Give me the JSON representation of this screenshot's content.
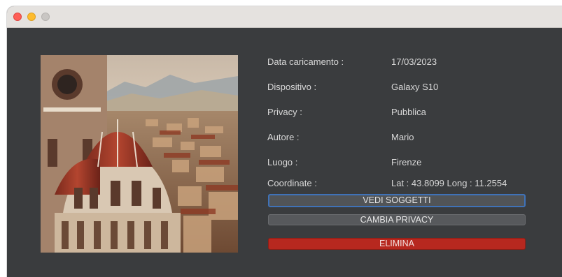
{
  "window": {
    "controls": [
      "close",
      "minimize",
      "zoom"
    ]
  },
  "photo": {
    "description_icon": "image-thumbnail"
  },
  "details": {
    "upload_date_label": "Data caricamento :",
    "upload_date_value": "17/03/2023",
    "device_label": "Dispositivo :",
    "device_value": "Galaxy S10",
    "privacy_label": "Privacy :",
    "privacy_value": "Pubblica",
    "author_label": "Autore :",
    "author_value": "Mario",
    "place_label": "Luogo :",
    "place_value": "Firenze",
    "coords_label": "Coordinate :",
    "coords_value": "Lat : 43.8099 Long : 11.2554"
  },
  "actions": {
    "view_subjects": "VEDI SOGGETTI",
    "change_privacy": "CAMBIA PRIVACY",
    "delete": "ELIMINA"
  },
  "colors": {
    "window_bg": "#3a3c3e",
    "delete_button": "#b7281f",
    "focus_ring": "#3f72b8"
  }
}
